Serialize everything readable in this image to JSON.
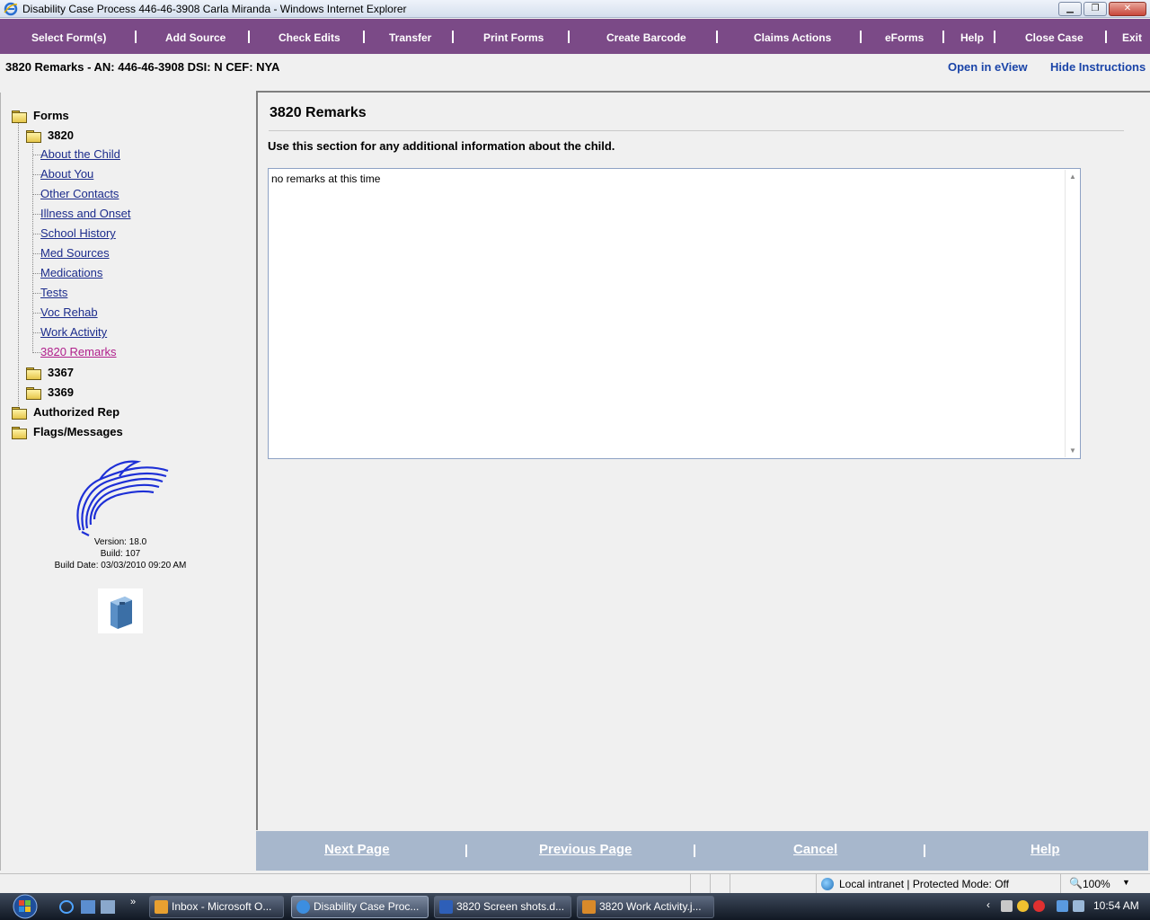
{
  "window": {
    "title": "Disability Case Process 446-46-3908 Carla Miranda - Windows Internet Explorer",
    "minimize_label": "▁",
    "maximize_label": "❐",
    "close_label": "✕"
  },
  "menubar": {
    "items": [
      "Select Form(s)",
      "Add Source",
      "Check Edits",
      "Transfer",
      "Print Forms",
      "Create Barcode",
      "Claims Actions",
      "eForms",
      "Help",
      "Close Case",
      "Exit"
    ],
    "background": "#7b4a87"
  },
  "header": {
    "case_info": "3820 Remarks - AN: 446-46-3908 DSI: N   CEF: NYA",
    "open_eview": "Open in eView",
    "hide_instructions": "Hide Instructions"
  },
  "sidebar": {
    "forms_label": "Forms",
    "form_3820": "3820",
    "links": [
      "About the Child",
      "About You",
      "Other Contacts",
      "Illness and Onset",
      "School History",
      "Med Sources",
      "Medications",
      "Tests",
      "Voc Rehab",
      "Work Activity",
      "3820 Remarks"
    ],
    "active_link": "3820 Remarks",
    "form_3367": "3367",
    "form_3369": "3369",
    "authorized_rep": "Authorized Rep",
    "flags_messages": "Flags/Messages",
    "version": "Version: 18.0",
    "build": "Build: 107",
    "build_date": "Build Date: 03/03/2010 09:20 AM"
  },
  "main": {
    "title": "3820 Remarks",
    "instruction": "Use this section for any additional information about the child.",
    "remarks_value": "no remarks at this time"
  },
  "bottomnav": {
    "next": "Next Page",
    "previous": "Previous Page",
    "cancel": "Cancel",
    "help": "Help"
  },
  "statusbar": {
    "zone": "Local intranet | Protected Mode: Off",
    "zoom": "100%"
  },
  "taskbar": {
    "tasks": [
      "Inbox - Microsoft O...",
      "Disability Case Proc...",
      "3820 Screen shots.d...",
      "3820 Work Activity.j..."
    ],
    "clock": "10:54 AM"
  },
  "colors": {
    "menu_purple": "#7b4a87",
    "link_blue": "#1c2c8c",
    "active_link": "#b0208c",
    "bottom_nav": "#a7b7cc"
  }
}
